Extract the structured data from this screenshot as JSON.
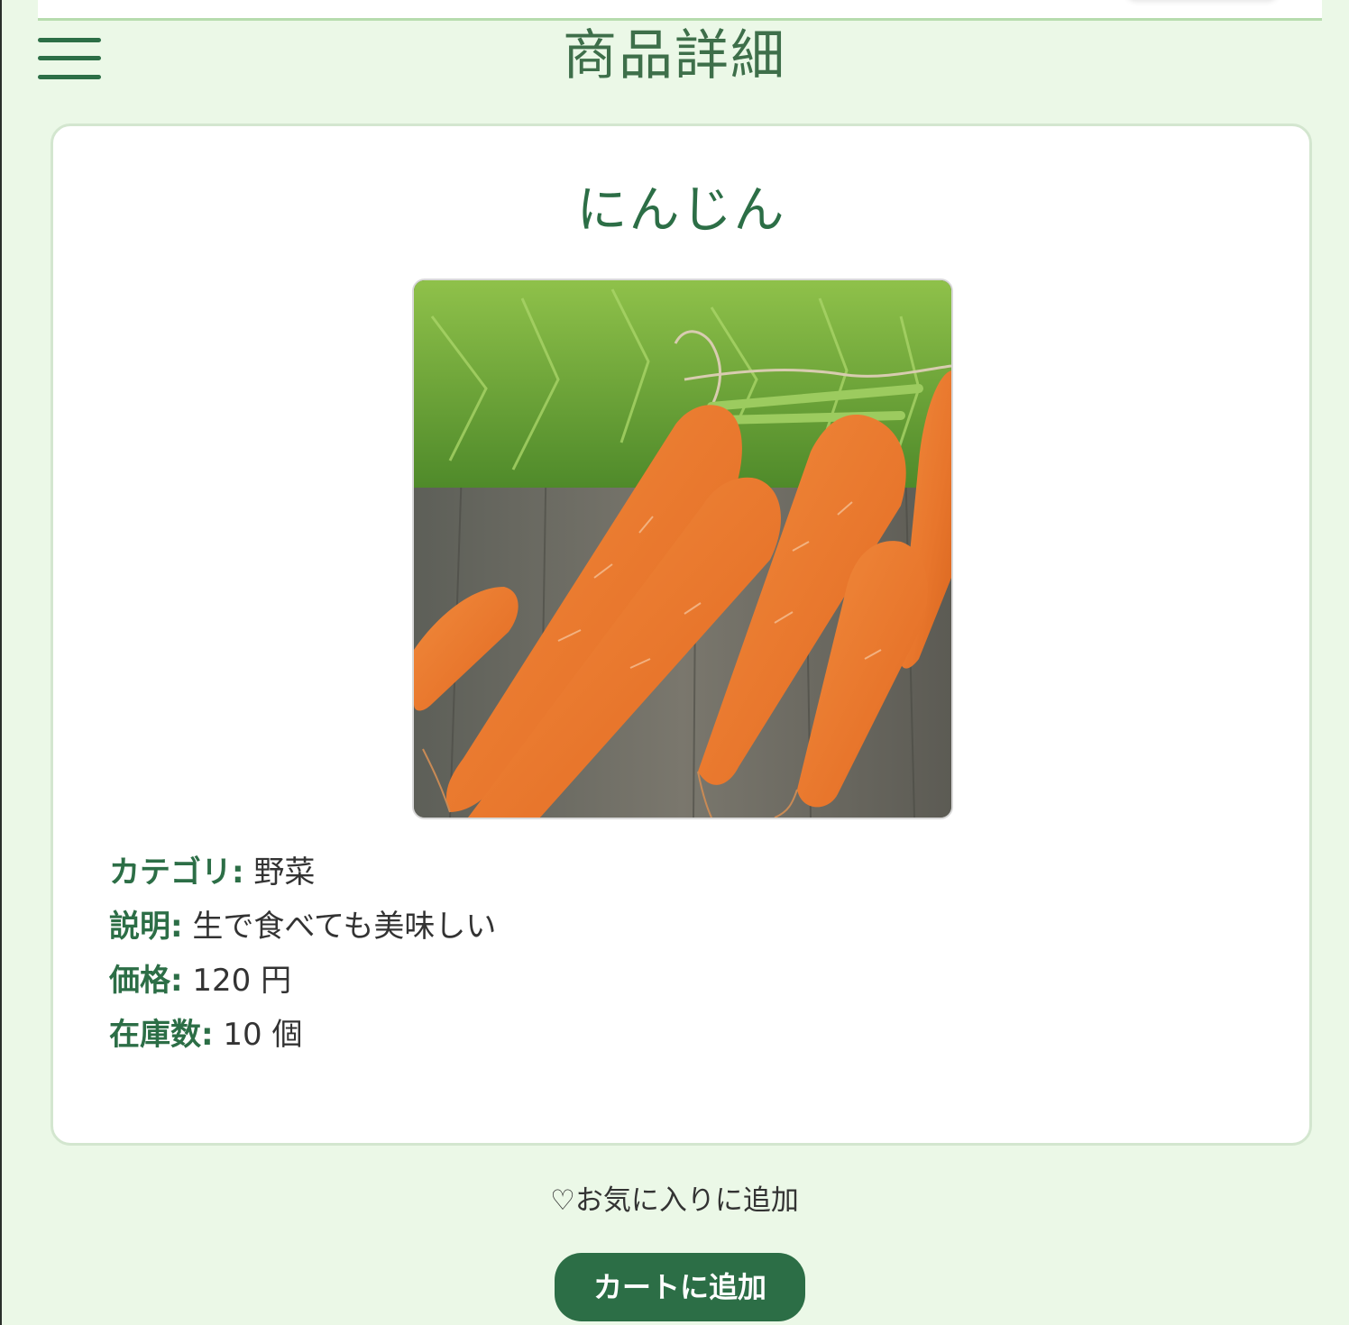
{
  "header": {
    "title": "商品詳細",
    "menu_icon": "hamburger-menu-icon"
  },
  "product": {
    "name": "にんじん",
    "image_alt": "にんじん",
    "details": [
      {
        "label": "カテゴリ:",
        "value": "野菜"
      },
      {
        "label": "説明:",
        "value": "生で食べても美味しい"
      },
      {
        "label": "価格:",
        "value": "120 円"
      },
      {
        "label": "在庫数:",
        "value": "10 個"
      }
    ]
  },
  "actions": {
    "favorite_label": "♡お気に入りに追加",
    "add_to_cart_label": "カートに追加"
  },
  "colors": {
    "page_background": "#ebf8e7",
    "accent": "#2c6e46",
    "title": "#3e6f4a",
    "card_border": "#d3e6cf",
    "text": "#333333"
  }
}
